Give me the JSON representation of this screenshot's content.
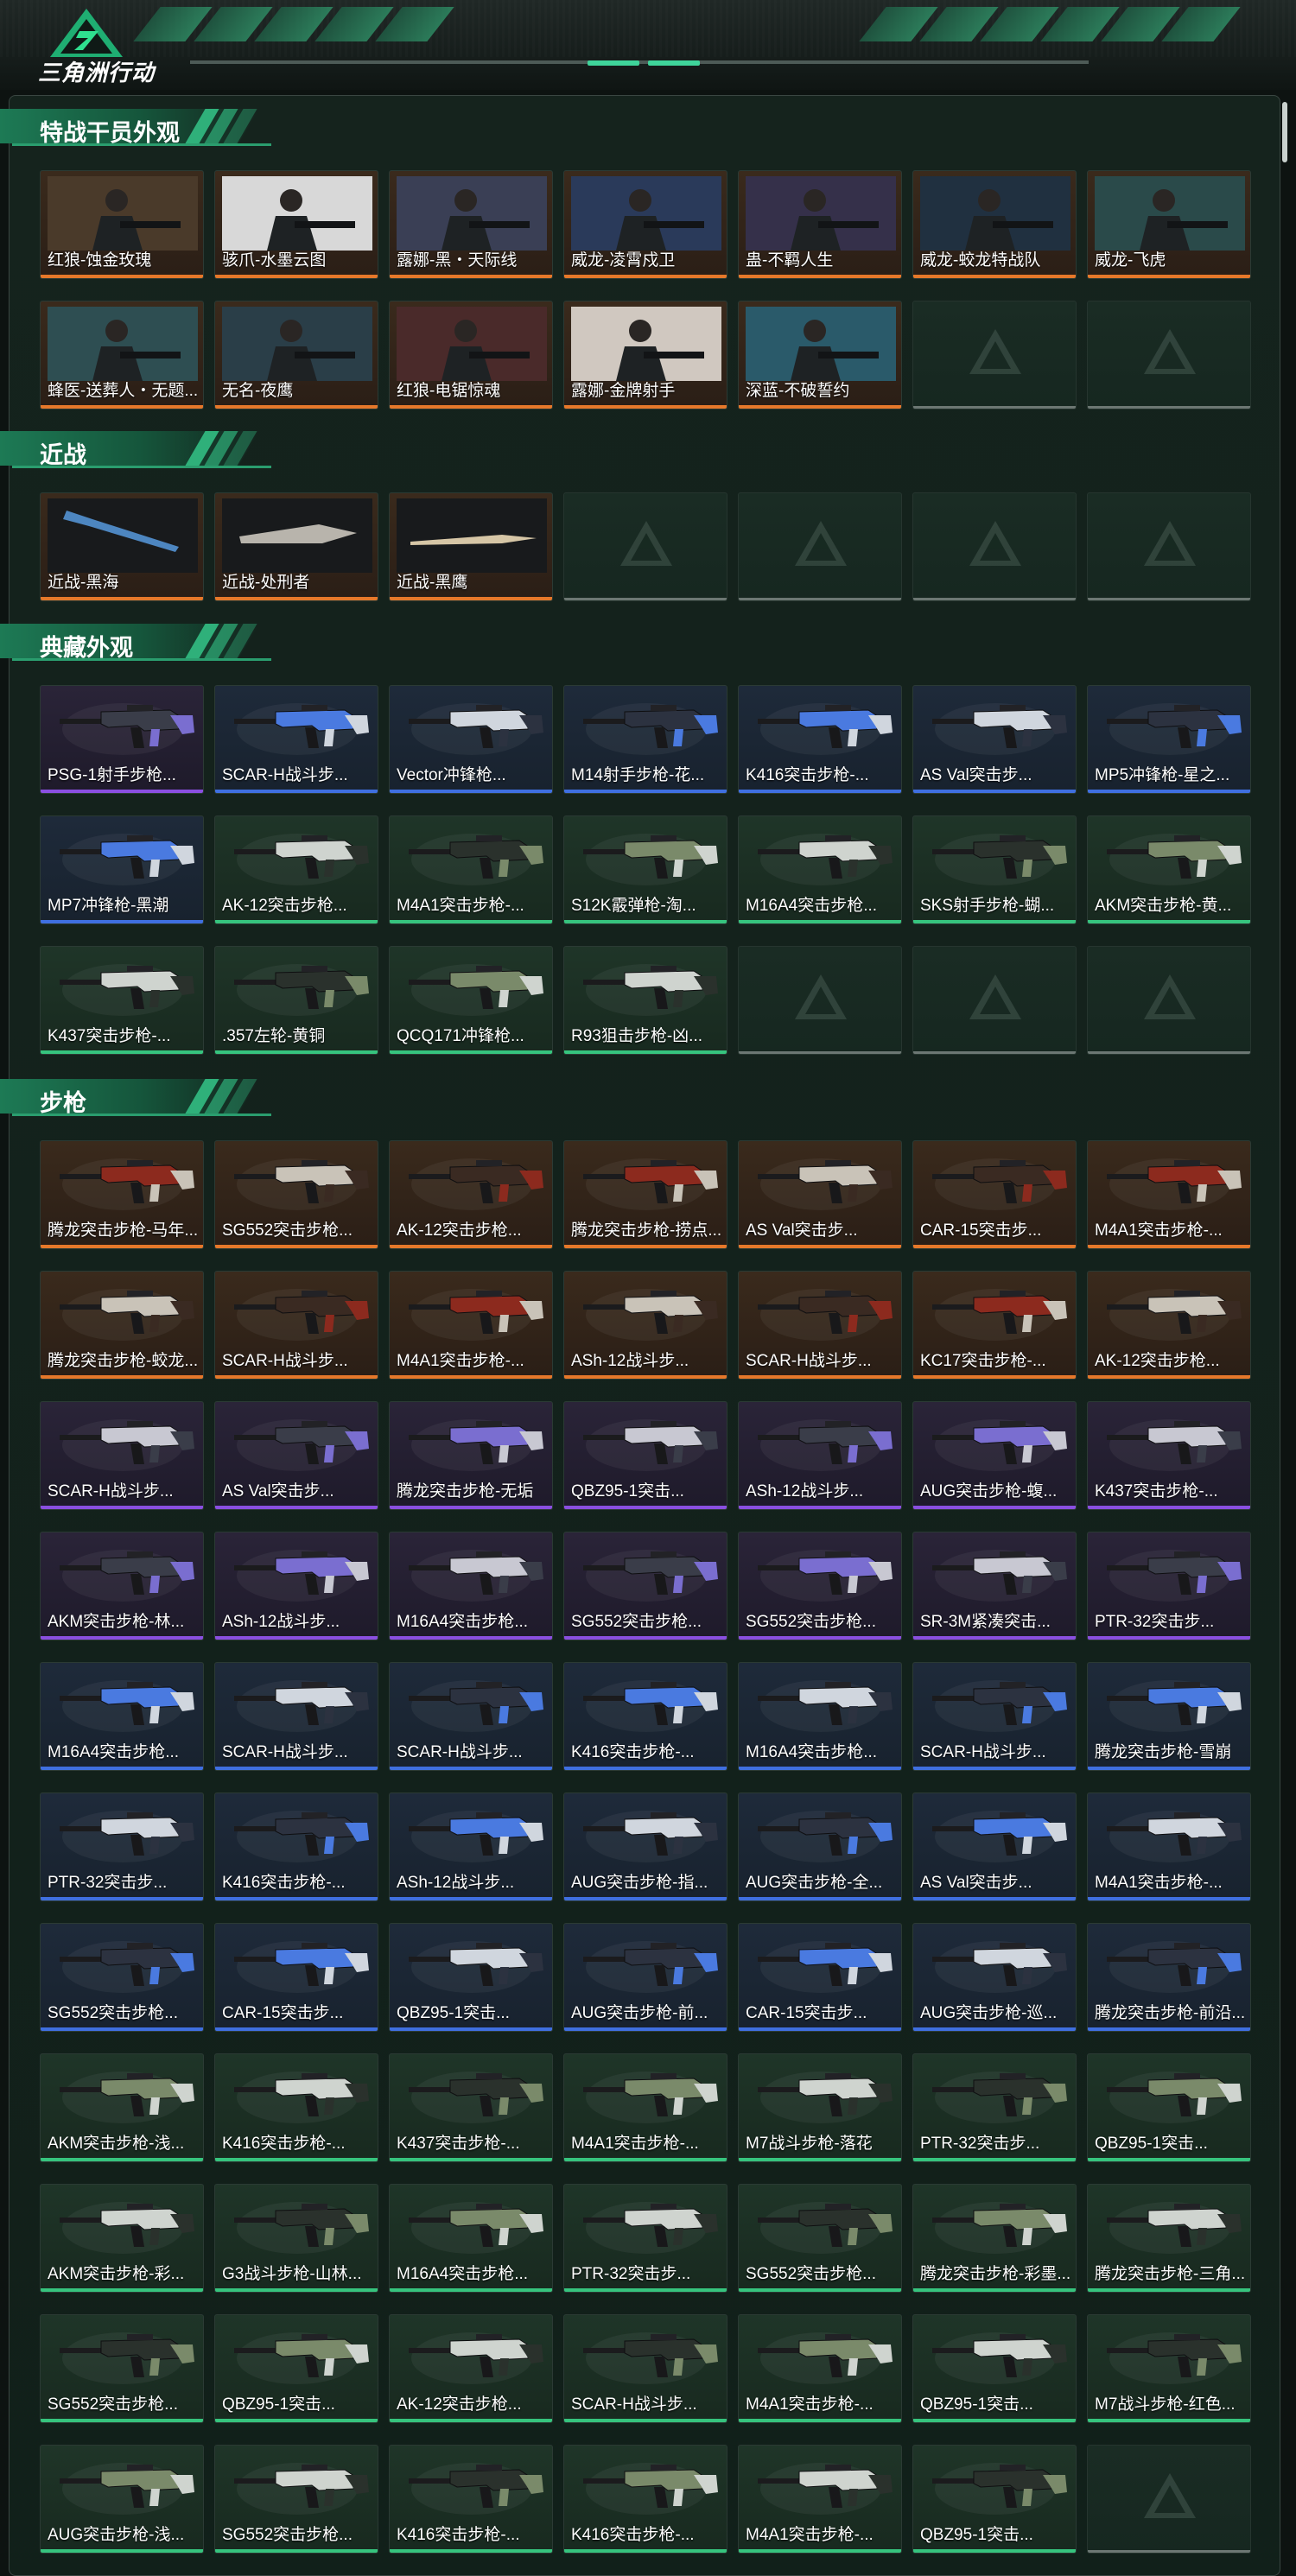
{
  "app": {
    "title": "三角洲行动"
  },
  "colors": {
    "gold": "#e6782a",
    "purple": "#8a4fe0",
    "blue": "#3f6fe0",
    "green": "#36c47e",
    "white": "#bfc8c4",
    "empty": "#6c7773"
  },
  "sections": [
    {
      "title": "特战干员外观",
      "card_type": "operator",
      "items": [
        {
          "name": "红狼-蚀金玫瑰",
          "rarity": "gold"
        },
        {
          "name": "骇爪-水墨云图",
          "rarity": "gold"
        },
        {
          "name": "露娜-黑・天际线",
          "rarity": "gold"
        },
        {
          "name": "威龙-凌霄戍卫",
          "rarity": "gold"
        },
        {
          "name": "蛊-不羁人生",
          "rarity": "gold"
        },
        {
          "name": "威龙-蛟龙特战队",
          "rarity": "gold"
        },
        {
          "name": "威龙-飞虎",
          "rarity": "gold"
        },
        {
          "name": "蜂医-送葬人・无题...",
          "rarity": "gold"
        },
        {
          "name": "无名-夜鹰",
          "rarity": "gold"
        },
        {
          "name": "红狼-电锯惊魂",
          "rarity": "gold"
        },
        {
          "name": "露娜-金牌射手",
          "rarity": "gold"
        },
        {
          "name": "深蓝-不破誓约",
          "rarity": "gold"
        },
        {
          "name": "",
          "rarity": "empty"
        },
        {
          "name": "",
          "rarity": "empty"
        }
      ]
    },
    {
      "title": "近战",
      "card_type": "melee",
      "items": [
        {
          "name": "近战-黑海",
          "rarity": "gold"
        },
        {
          "name": "近战-处刑者",
          "rarity": "gold"
        },
        {
          "name": "近战-黑鹰",
          "rarity": "gold"
        },
        {
          "name": "",
          "rarity": "empty"
        },
        {
          "name": "",
          "rarity": "empty"
        },
        {
          "name": "",
          "rarity": "empty"
        },
        {
          "name": "",
          "rarity": "empty"
        }
      ]
    },
    {
      "title": "典藏外观",
      "card_type": "weapon",
      "items": [
        {
          "name": "PSG-1射手步枪...",
          "rarity": "purple"
        },
        {
          "name": "SCAR-H战斗步...",
          "rarity": "blue"
        },
        {
          "name": "Vector冲锋枪...",
          "rarity": "blue"
        },
        {
          "name": "M14射手步枪-花...",
          "rarity": "blue"
        },
        {
          "name": "K416突击步枪-...",
          "rarity": "blue"
        },
        {
          "name": "AS Val突击步...",
          "rarity": "blue"
        },
        {
          "name": "MP5冲锋枪-星之...",
          "rarity": "blue"
        },
        {
          "name": "MP7冲锋枪-黑潮",
          "rarity": "blue"
        },
        {
          "name": "AK-12突击步枪...",
          "rarity": "green"
        },
        {
          "name": "M4A1突击步枪-...",
          "rarity": "green"
        },
        {
          "name": "S12K霰弹枪-淘...",
          "rarity": "green"
        },
        {
          "name": "M16A4突击步枪...",
          "rarity": "green"
        },
        {
          "name": "SKS射手步枪-蝴...",
          "rarity": "green"
        },
        {
          "name": "AKM突击步枪-黄...",
          "rarity": "green"
        },
        {
          "name": "K437突击步枪-...",
          "rarity": "green"
        },
        {
          "name": ".357左轮-黄铜",
          "rarity": "green"
        },
        {
          "name": "QCQ171冲锋枪...",
          "rarity": "green"
        },
        {
          "name": "R93狙击步枪-凶...",
          "rarity": "green"
        },
        {
          "name": "",
          "rarity": "empty"
        },
        {
          "name": "",
          "rarity": "empty"
        },
        {
          "name": "",
          "rarity": "empty"
        }
      ]
    },
    {
      "title": "步枪",
      "card_type": "weapon",
      "items": [
        {
          "name": "腾龙突击步枪-马年...",
          "rarity": "gold"
        },
        {
          "name": "SG552突击步枪...",
          "rarity": "gold"
        },
        {
          "name": "AK-12突击步枪...",
          "rarity": "gold"
        },
        {
          "name": "腾龙突击步枪-捞点...",
          "rarity": "gold"
        },
        {
          "name": "AS Val突击步...",
          "rarity": "gold"
        },
        {
          "name": "CAR-15突击步...",
          "rarity": "gold"
        },
        {
          "name": "M4A1突击步枪-...",
          "rarity": "gold"
        },
        {
          "name": "腾龙突击步枪-蛟龙...",
          "rarity": "gold"
        },
        {
          "name": "SCAR-H战斗步...",
          "rarity": "gold"
        },
        {
          "name": "M4A1突击步枪-...",
          "rarity": "gold"
        },
        {
          "name": "ASh-12战斗步...",
          "rarity": "gold"
        },
        {
          "name": "SCAR-H战斗步...",
          "rarity": "gold"
        },
        {
          "name": "KC17突击步枪-...",
          "rarity": "gold"
        },
        {
          "name": "AK-12突击步枪...",
          "rarity": "gold"
        },
        {
          "name": "SCAR-H战斗步...",
          "rarity": "purple"
        },
        {
          "name": "AS Val突击步...",
          "rarity": "purple"
        },
        {
          "name": "腾龙突击步枪-无垢",
          "rarity": "purple"
        },
        {
          "name": "QBZ95-1突击...",
          "rarity": "purple"
        },
        {
          "name": "ASh-12战斗步...",
          "rarity": "purple"
        },
        {
          "name": "AUG突击步枪-蝮...",
          "rarity": "purple"
        },
        {
          "name": "K437突击步枪-...",
          "rarity": "purple"
        },
        {
          "name": "AKM突击步枪-林...",
          "rarity": "purple"
        },
        {
          "name": "ASh-12战斗步...",
          "rarity": "purple"
        },
        {
          "name": "M16A4突击步枪...",
          "rarity": "purple"
        },
        {
          "name": "SG552突击步枪...",
          "rarity": "purple"
        },
        {
          "name": "SG552突击步枪...",
          "rarity": "purple"
        },
        {
          "name": "SR-3M紧凑突击...",
          "rarity": "purple"
        },
        {
          "name": "PTR-32突击步...",
          "rarity": "purple"
        },
        {
          "name": "M16A4突击步枪...",
          "rarity": "blue"
        },
        {
          "name": "SCAR-H战斗步...",
          "rarity": "blue"
        },
        {
          "name": "SCAR-H战斗步...",
          "rarity": "blue"
        },
        {
          "name": "K416突击步枪-...",
          "rarity": "blue"
        },
        {
          "name": "M16A4突击步枪...",
          "rarity": "blue"
        },
        {
          "name": "SCAR-H战斗步...",
          "rarity": "blue"
        },
        {
          "name": "腾龙突击步枪-雪崩",
          "rarity": "blue"
        },
        {
          "name": "PTR-32突击步...",
          "rarity": "blue"
        },
        {
          "name": "K416突击步枪-...",
          "rarity": "blue"
        },
        {
          "name": "ASh-12战斗步...",
          "rarity": "blue"
        },
        {
          "name": "AUG突击步枪-指...",
          "rarity": "blue"
        },
        {
          "name": "AUG突击步枪-全...",
          "rarity": "blue"
        },
        {
          "name": "AS Val突击步...",
          "rarity": "blue"
        },
        {
          "name": "M4A1突击步枪-...",
          "rarity": "blue"
        },
        {
          "name": "SG552突击步枪...",
          "rarity": "blue"
        },
        {
          "name": "CAR-15突击步...",
          "rarity": "blue"
        },
        {
          "name": "QBZ95-1突击...",
          "rarity": "blue"
        },
        {
          "name": "AUG突击步枪-前...",
          "rarity": "blue"
        },
        {
          "name": "CAR-15突击步...",
          "rarity": "blue"
        },
        {
          "name": "AUG突击步枪-巡...",
          "rarity": "blue"
        },
        {
          "name": "腾龙突击步枪-前沿...",
          "rarity": "blue"
        },
        {
          "name": "AKM突击步枪-浅...",
          "rarity": "green"
        },
        {
          "name": "K416突击步枪-...",
          "rarity": "green"
        },
        {
          "name": "K437突击步枪-...",
          "rarity": "green"
        },
        {
          "name": "M4A1突击步枪-...",
          "rarity": "green"
        },
        {
          "name": "M7战斗步枪-落花",
          "rarity": "green"
        },
        {
          "name": "PTR-32突击步...",
          "rarity": "green"
        },
        {
          "name": "QBZ95-1突击...",
          "rarity": "green"
        },
        {
          "name": "AKM突击步枪-彩...",
          "rarity": "green"
        },
        {
          "name": "G3战斗步枪-山林...",
          "rarity": "green"
        },
        {
          "name": "M16A4突击步枪...",
          "rarity": "green"
        },
        {
          "name": "PTR-32突击步...",
          "rarity": "green"
        },
        {
          "name": "SG552突击步枪...",
          "rarity": "green"
        },
        {
          "name": "腾龙突击步枪-彩墨...",
          "rarity": "green"
        },
        {
          "name": "腾龙突击步枪-三角...",
          "rarity": "green"
        },
        {
          "name": "SG552突击步枪...",
          "rarity": "green"
        },
        {
          "name": "QBZ95-1突击...",
          "rarity": "green"
        },
        {
          "name": "AK-12突击步枪...",
          "rarity": "green"
        },
        {
          "name": "SCAR-H战斗步...",
          "rarity": "green"
        },
        {
          "name": "M4A1突击步枪-...",
          "rarity": "green"
        },
        {
          "name": "QBZ95-1突击...",
          "rarity": "green"
        },
        {
          "name": "M7战斗步枪-红色...",
          "rarity": "green"
        },
        {
          "name": "AUG突击步枪-浅...",
          "rarity": "green"
        },
        {
          "name": "SG552突击步枪...",
          "rarity": "green"
        },
        {
          "name": "K416突击步枪-...",
          "rarity": "green"
        },
        {
          "name": "K416突击步枪-...",
          "rarity": "green"
        },
        {
          "name": "M4A1突击步枪-...",
          "rarity": "green"
        },
        {
          "name": "QBZ95-1突击...",
          "rarity": "green"
        },
        {
          "name": "",
          "rarity": "empty"
        }
      ]
    }
  ]
}
